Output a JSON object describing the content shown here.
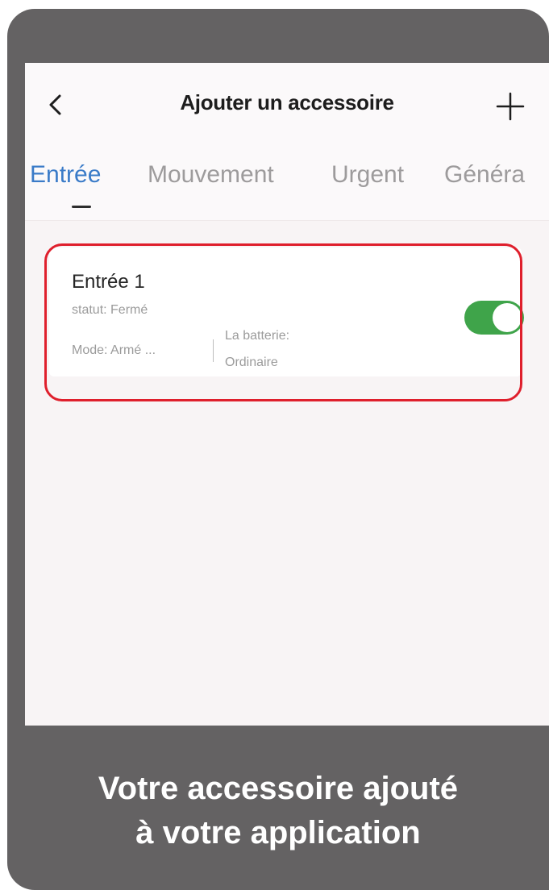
{
  "header": {
    "back_icon": "chevron-left-icon",
    "title": "Ajouter un accessoire",
    "add_icon": "plus-icon"
  },
  "tabs": [
    {
      "label": "Entrée",
      "active": true
    },
    {
      "label": "Mouvement",
      "active": false
    },
    {
      "label": "Urgent",
      "active": false
    },
    {
      "label": "Généra",
      "active": false
    }
  ],
  "device": {
    "name": "Entrée 1",
    "status": "statut: Fermé",
    "mode": "Mode: Armé ...",
    "battery_label": "La batterie:",
    "battery_value": "Ordinaire",
    "toggle_on": true
  },
  "caption": {
    "line1": "Votre accessoire ajouté",
    "line2": "à votre application"
  },
  "colors": {
    "accent_tab": "#3a7bc8",
    "toggle_on": "#3fa44a",
    "highlight": "#df1f2c",
    "frame": "#646263"
  }
}
